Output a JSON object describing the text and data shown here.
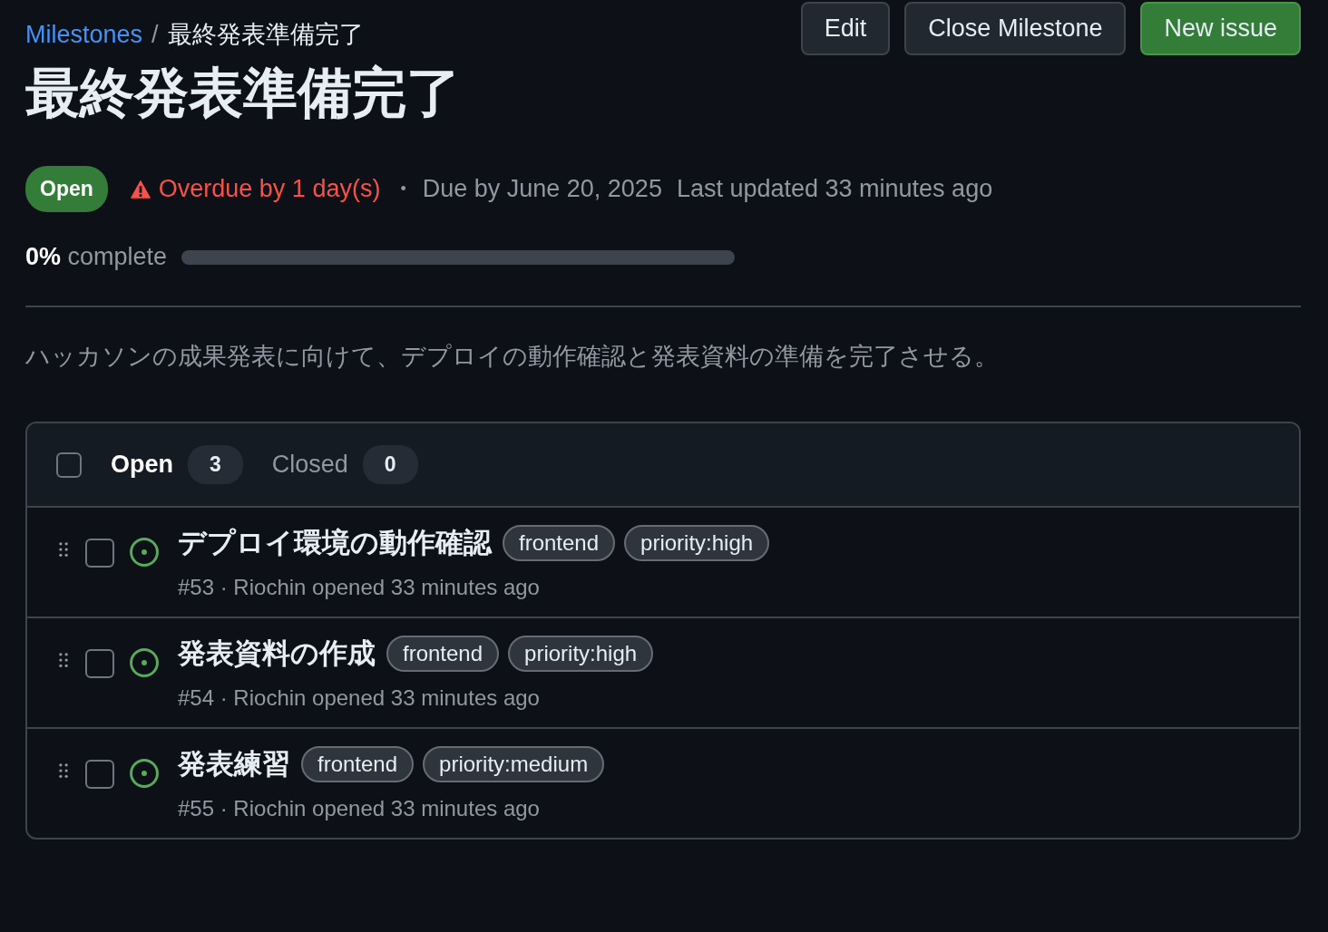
{
  "breadcrumb": {
    "link": "Milestones",
    "separator": "/",
    "current": "最終発表準備完了"
  },
  "actions": [
    {
      "label": "Edit",
      "kind": "default"
    },
    {
      "label": "Close Milestone",
      "kind": "default"
    },
    {
      "label": "New issue",
      "kind": "primary"
    }
  ],
  "title": "最終発表準備完了",
  "status": {
    "state": "Open",
    "overdue": "Overdue by 1 day(s)",
    "separator": "•",
    "due": "Due by June 20, 2025",
    "updated": "Last updated 33 minutes ago"
  },
  "progress": {
    "label": "**0%** complete",
    "level": 0
  },
  "description": "ハッカソンの成果発表に向けて、デプロイの動作確認と発表資料の準備を完了させる。",
  "list": {
    "select_all": {
      "checked": false
    },
    "tabs": [
      {
        "label": "Open",
        "count": "3",
        "selected": true
      },
      {
        "label": "Closed",
        "count": "0",
        "selected": false
      }
    ],
    "issues": [
      {
        "title": "デプロイ環境の動作確認",
        "labels": [
          "frontend",
          "priority:high"
        ],
        "meta": "#53 · Riochin opened 33 minutes ago",
        "checked": false
      },
      {
        "title": "発表資料の作成",
        "labels": [
          "frontend",
          "priority:high"
        ],
        "meta": "#54 · Riochin opened 33 minutes ago",
        "checked": false
      },
      {
        "title": "発表練習",
        "labels": [
          "frontend",
          "priority:medium"
        ],
        "meta": "#55 · Riochin opened 33 minutes ago",
        "checked": false
      }
    ]
  }
}
